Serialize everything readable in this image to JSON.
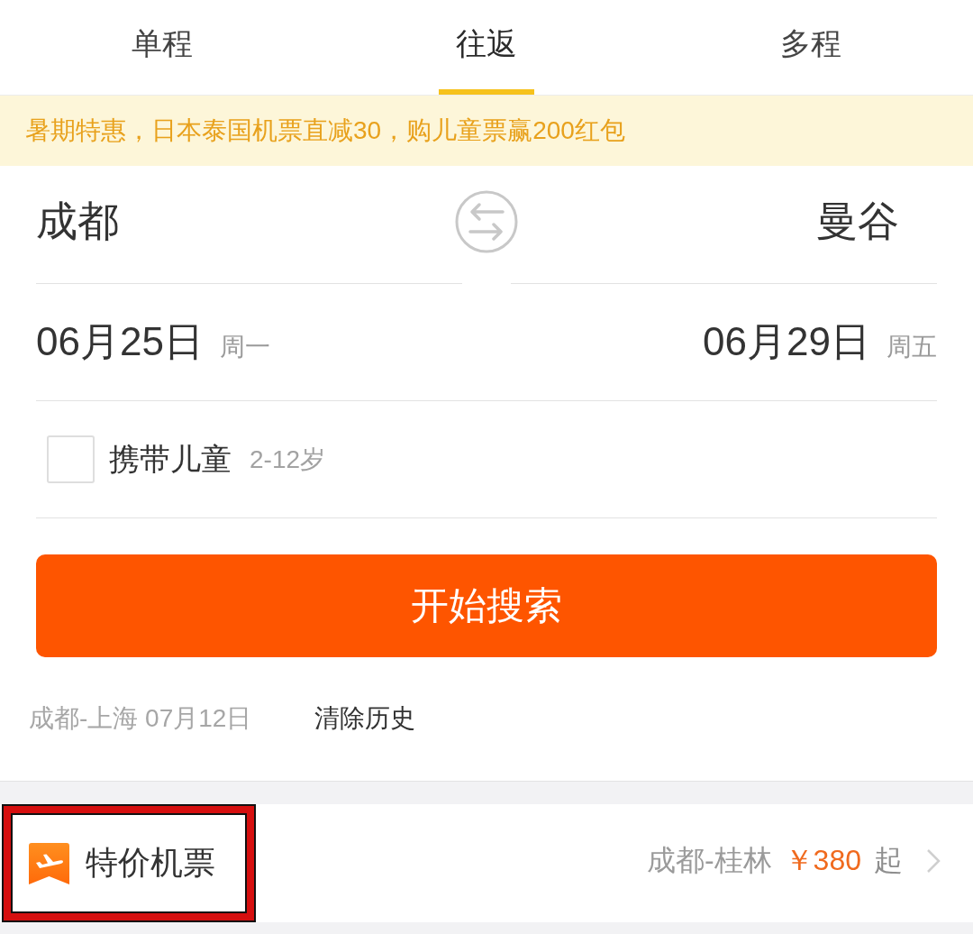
{
  "tabs": [
    {
      "label": "单程",
      "selected": false
    },
    {
      "label": "往返",
      "selected": true
    },
    {
      "label": "多程",
      "selected": false
    }
  ],
  "banner": {
    "text": "暑期特惠，日本泰国机票直减30，购儿童票赢200红包"
  },
  "route": {
    "origin": "成都",
    "destination": "曼谷"
  },
  "dates": {
    "depart": {
      "date": "06月25日",
      "weekday": "周一"
    },
    "return": {
      "date": "06月29日",
      "weekday": "周五"
    }
  },
  "child_option": {
    "label": "携带儿童",
    "note": "2-12岁",
    "checked": false
  },
  "search_button": {
    "label": "开始搜索"
  },
  "history": {
    "entries": [
      "成都-上海 07月12日"
    ],
    "clear_label": "清除历史"
  },
  "deals": {
    "title": "特价机票",
    "highlighted": true,
    "route": "成都-桂林",
    "price": "￥380",
    "suffix": "起"
  }
}
